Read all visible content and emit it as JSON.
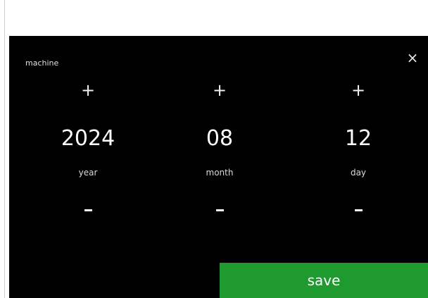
{
  "dialog": {
    "context_label": "machine",
    "close_glyph": "×",
    "save_label": "save"
  },
  "fields": {
    "year": {
      "value": "2024",
      "label": "year",
      "increment": "+",
      "decrement_icon": "minus-icon"
    },
    "month": {
      "value": "08",
      "label": "month",
      "increment": "+",
      "decrement_icon": "minus-icon"
    },
    "day": {
      "value": "12",
      "label": "day",
      "increment": "+",
      "decrement_icon": "minus-icon"
    }
  },
  "colors": {
    "background": "#000000",
    "save_button": "#1f9a2e",
    "text": "#ffffff"
  }
}
